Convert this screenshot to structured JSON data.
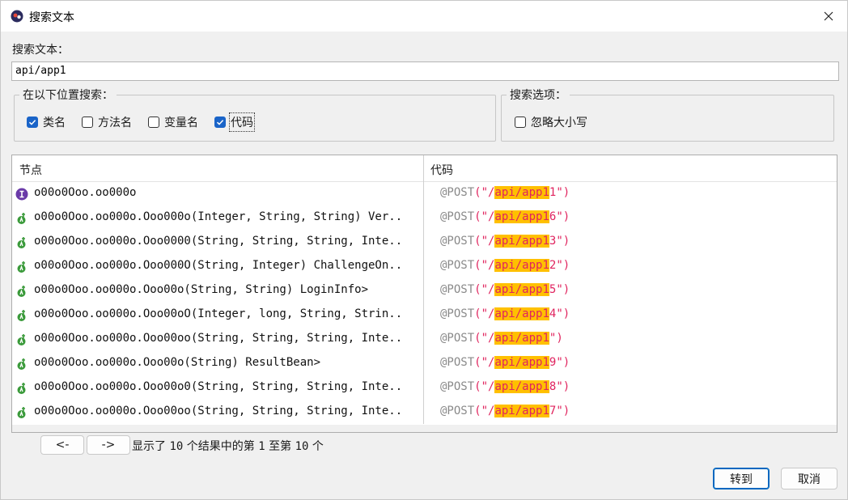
{
  "window": {
    "title": "搜索文本"
  },
  "search": {
    "label": "搜索文本：",
    "value": "api/app1"
  },
  "location_group": {
    "legend": "在以下位置搜索：",
    "options": [
      {
        "label": "类名",
        "checked": true
      },
      {
        "label": "方法名",
        "checked": false
      },
      {
        "label": "变量名",
        "checked": false
      },
      {
        "label": "代码",
        "checked": true
      }
    ]
  },
  "options_group": {
    "legend": "搜索选项：",
    "options": [
      {
        "label": "忽略大小写",
        "checked": false
      }
    ]
  },
  "table": {
    "columns": [
      "节点",
      "代码"
    ],
    "rows": [
      {
        "icon": "interface-icon",
        "node": "o00o0Ooo.oo000o",
        "code_prefix": "@POST",
        "code_open": "(\"/",
        "code_match": "api/app1",
        "code_rest": "1\")"
      },
      {
        "icon": "method-icon",
        "node": "o00o0Ooo.oo000o.Ooo000o(Integer, String, String) Ver..",
        "code_prefix": "@POST",
        "code_open": "(\"/",
        "code_match": "api/app1",
        "code_rest": "6\")"
      },
      {
        "icon": "method-icon",
        "node": "o00o0Ooo.oo000o.Ooo0000(String, String, String, Inte..",
        "code_prefix": "@POST",
        "code_open": "(\"/",
        "code_match": "api/app1",
        "code_rest": "3\")"
      },
      {
        "icon": "method-icon",
        "node": "o00o0Ooo.oo000o.Ooo000O(String, Integer) ChallengeOn..",
        "code_prefix": "@POST",
        "code_open": "(\"/",
        "code_match": "api/app1",
        "code_rest": "2\")"
      },
      {
        "icon": "method-icon",
        "node": "o00o0Ooo.oo000o.Ooo00o(String, String) LoginInfo>",
        "code_prefix": "@POST",
        "code_open": "(\"/",
        "code_match": "api/app1",
        "code_rest": "5\")"
      },
      {
        "icon": "method-icon",
        "node": "o00o0Ooo.oo000o.Ooo00oO(Integer, long, String, Strin..",
        "code_prefix": "@POST",
        "code_open": "(\"/",
        "code_match": "api/app1",
        "code_rest": "4\")"
      },
      {
        "icon": "method-icon",
        "node": "o00o0Ooo.oo000o.Ooo00oo(String, String, String, Inte..",
        "code_prefix": "@POST",
        "code_open": "(\"/",
        "code_match": "api/app1",
        "code_rest": "\")"
      },
      {
        "icon": "method-icon",
        "node": "o00o0Ooo.oo000o.Ooo00o(String) ResultBean>",
        "code_prefix": "@POST",
        "code_open": "(\"/",
        "code_match": "api/app1",
        "code_rest": "9\")"
      },
      {
        "icon": "method-icon",
        "node": "o00o0Ooo.oo000o.Ooo00o0(String, String, String, Inte..",
        "code_prefix": "@POST",
        "code_open": "(\"/",
        "code_match": "api/app1",
        "code_rest": "8\")"
      },
      {
        "icon": "method-icon",
        "node": "o00o0Ooo.oo000o.Ooo00oo(String, String, String, Inte..",
        "code_prefix": "@POST",
        "code_open": "(\"/",
        "code_match": "api/app1",
        "code_rest": "7\")"
      }
    ]
  },
  "pager": {
    "prev_label": "<-",
    "next_label": "->",
    "status_a": "显示了 ",
    "total": "10",
    "status_b": " 个结果中的第 ",
    "from": "1",
    "status_c": " 至第 ",
    "to": "10",
    "status_d": " 个"
  },
  "buttons": {
    "go": "转到",
    "cancel": "取消"
  },
  "colors": {
    "accent": "#1a64c8",
    "highlight": "#ffc000",
    "string": "#e0245e",
    "annotation": "#8a8a8a",
    "method_icon": "#3a9a3a",
    "interface_icon": "#6a3aa8"
  }
}
